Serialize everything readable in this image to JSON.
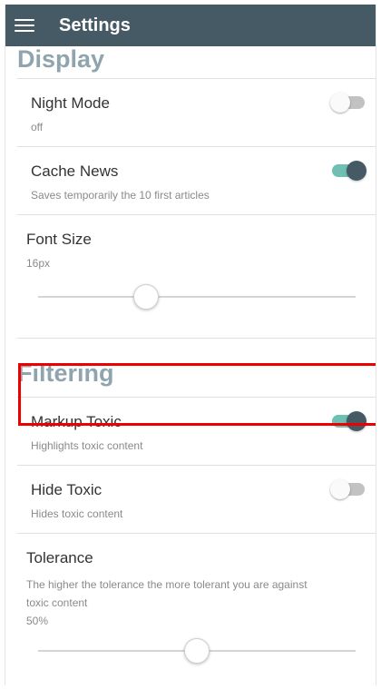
{
  "appbar": {
    "title": "Settings",
    "menu_icon": "hamburger-menu-icon"
  },
  "display": {
    "section_title": "Display",
    "night_mode": {
      "label": "Night Mode",
      "value": "off",
      "enabled": false
    },
    "cache_news": {
      "label": "Cache News",
      "description": "Saves temporarily the 10 first articles",
      "enabled": true
    },
    "font_size": {
      "label": "Font Size",
      "value": "16px",
      "slider_fraction": 0.34
    }
  },
  "filtering": {
    "section_title": "Filtering",
    "markup_toxic": {
      "label": "Markup Toxic",
      "description": "Highlights toxic content",
      "enabled": true
    },
    "hide_toxic": {
      "label": "Hide Toxic",
      "description": "Hides toxic content",
      "enabled": false
    },
    "tolerance": {
      "label": "Tolerance",
      "description_line1": "The higher the tolerance the more tolerant you are against",
      "description_line2": "toxic content",
      "value": "50%",
      "slider_fraction": 0.5
    }
  },
  "colors": {
    "appbar": "#455a64",
    "accent_track": "#6fbfb2",
    "section_title": "#90a4ae",
    "highlight_box": "#ee0000"
  }
}
